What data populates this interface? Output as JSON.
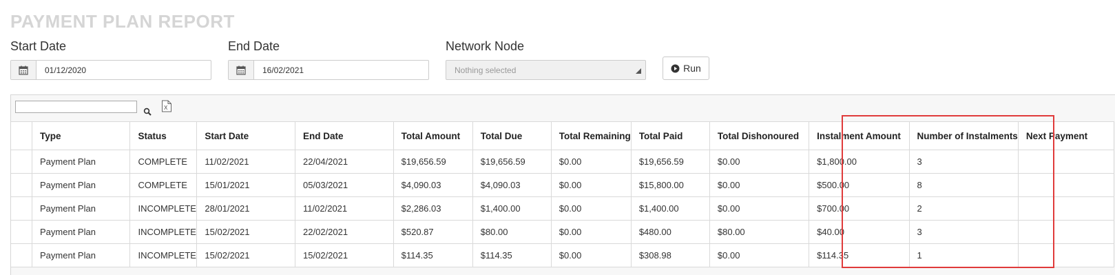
{
  "report": {
    "title": "PAYMENT PLAN REPORT"
  },
  "filters": {
    "start_date": {
      "label": "Start Date",
      "value": "01/12/2020",
      "icon": "calendar-icon"
    },
    "end_date": {
      "label": "End Date",
      "value": "16/02/2021",
      "icon": "calendar-icon"
    },
    "network_node": {
      "label": "Network Node",
      "placeholder": "Nothing selected"
    },
    "run_label": "Run"
  },
  "grid": {
    "search_value": "",
    "columns": [
      "",
      "Type",
      "Status",
      "Start Date",
      "End Date",
      "Total Amount",
      "Total Due",
      "Total Remaining",
      "Total Paid",
      "Total Dishonoured",
      "Instalment Amount",
      "Number of Instalments",
      "Next Payment"
    ],
    "rows": [
      [
        "",
        "Payment Plan",
        "COMPLETE",
        "11/02/2021",
        "22/04/2021",
        "$19,656.59",
        "$19,656.59",
        "$0.00",
        "$19,656.59",
        "$0.00",
        "$1,800.00",
        "3",
        ""
      ],
      [
        "",
        "Payment Plan",
        "COMPLETE",
        "15/01/2021",
        "05/03/2021",
        "$4,090.03",
        "$4,090.03",
        "$0.00",
        "$15,800.00",
        "$0.00",
        "$500.00",
        "8",
        ""
      ],
      [
        "",
        "Payment Plan",
        "INCOMPLETE",
        "28/01/2021",
        "11/02/2021",
        "$2,286.03",
        "$1,400.00",
        "$0.00",
        "$1,400.00",
        "$0.00",
        "$700.00",
        "2",
        ""
      ],
      [
        "",
        "Payment Plan",
        "INCOMPLETE",
        "15/02/2021",
        "22/02/2021",
        "$520.87",
        "$80.00",
        "$0.00",
        "$480.00",
        "$80.00",
        "$40.00",
        "3",
        ""
      ],
      [
        "",
        "Payment Plan",
        "INCOMPLETE",
        "15/02/2021",
        "15/02/2021",
        "$114.35",
        "$114.35",
        "$0.00",
        "$308.98",
        "$0.00",
        "$114.35",
        "1",
        ""
      ]
    ]
  },
  "colors": {
    "highlight": "#e03a3a",
    "title": "#d5d5d5"
  }
}
